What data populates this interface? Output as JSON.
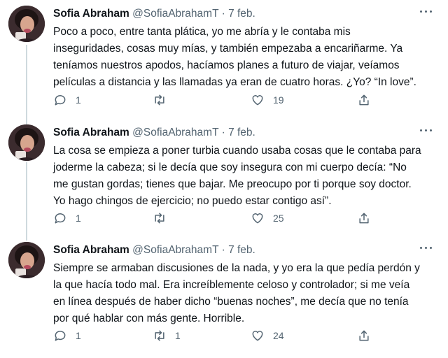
{
  "tweets": [
    {
      "name": "Sofia Abraham",
      "handle": "@SofiaAbrahamT",
      "sep": "·",
      "date": "7 feb.",
      "lines": [
        "Poco a poco, entre tanta plática, yo me abría y le contaba mis",
        "inseguridades, cosas muy mías, y también empezaba a encariñarme. Ya",
        "teníamos nuestros apodos, hacíamos planes a futuro de viajar, veíamos",
        "películas a distancia y las llamadas ya eran de cuatro horas. ¿Yo? “In love”."
      ],
      "replies": "1",
      "retweets": "",
      "likes": "19"
    },
    {
      "name": "Sofia Abraham",
      "handle": "@SofiaAbrahamT",
      "sep": "·",
      "date": "7 feb.",
      "lines": [
        "La cosa se empieza a poner turbia cuando usaba cosas que le contaba para",
        "joderme la cabeza; si le decía que soy insegura con mi cuerpo decía: “No",
        "me gustan gordas; tienes que bajar. Me preocupo por ti porque soy doctor.",
        "Yo hago chingos de ejercicio; no puedo estar contigo así”."
      ],
      "replies": "1",
      "retweets": "",
      "likes": "25"
    },
    {
      "name": "Sofia Abraham",
      "handle": "@SofiaAbrahamT",
      "sep": "·",
      "date": "7 feb.",
      "lines": [
        "Siempre se armaban discusiones de la nada, y yo era la que pedía perdón y",
        "la que hacía todo mal. Era increíblemente celoso y controlador; si me veía",
        "en línea después de haber dicho “buenas noches”, me decía que no tenía",
        "por qué hablar con más gente. Horrible."
      ],
      "replies": "1",
      "retweets": "1",
      "likes": "24"
    }
  ],
  "icons": {
    "reply": "reply-icon",
    "retweet": "retweet-icon",
    "like": "heart-icon",
    "share": "share-icon",
    "more": "more-icon"
  },
  "colors": {
    "text": "#0f1419",
    "secondary": "#536471",
    "thread_line": "#cfd9de"
  }
}
